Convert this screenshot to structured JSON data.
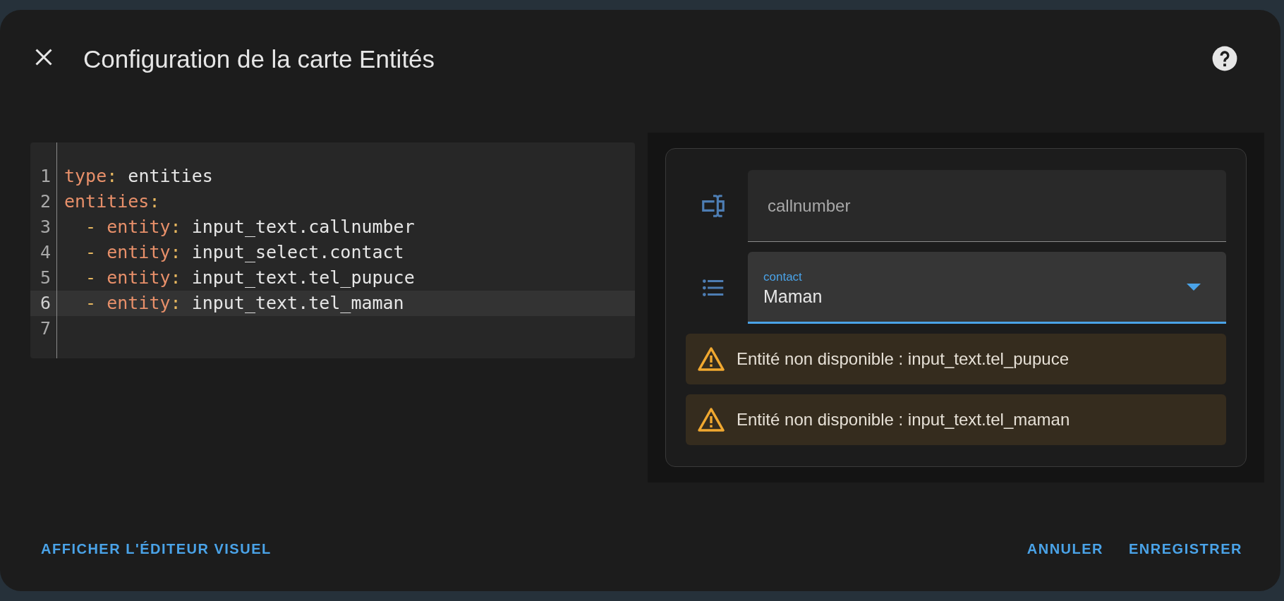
{
  "dialog": {
    "title": "Configuration de la carte Entités"
  },
  "editor": {
    "lines": [
      {
        "number": "1",
        "highlighted": false,
        "tokens": [
          {
            "text": "type",
            "kind": "key"
          },
          {
            "text": ":",
            "kind": "punct"
          },
          {
            "text": " entities",
            "kind": "value"
          }
        ]
      },
      {
        "number": "2",
        "highlighted": false,
        "tokens": [
          {
            "text": "entities",
            "kind": "key"
          },
          {
            "text": ":",
            "kind": "punct"
          }
        ]
      },
      {
        "number": "3",
        "highlighted": false,
        "tokens": [
          {
            "text": "  -",
            "kind": "punct"
          },
          {
            "text": " entity",
            "kind": "key"
          },
          {
            "text": ":",
            "kind": "punct"
          },
          {
            "text": " input_text.callnumber",
            "kind": "value"
          }
        ]
      },
      {
        "number": "4",
        "highlighted": false,
        "tokens": [
          {
            "text": "  -",
            "kind": "punct"
          },
          {
            "text": " entity",
            "kind": "key"
          },
          {
            "text": ":",
            "kind": "punct"
          },
          {
            "text": " input_select.contact",
            "kind": "value"
          }
        ]
      },
      {
        "number": "5",
        "highlighted": false,
        "tokens": [
          {
            "text": "  -",
            "kind": "punct"
          },
          {
            "text": " entity",
            "kind": "key"
          },
          {
            "text": ":",
            "kind": "punct"
          },
          {
            "text": " input_text.tel_pupuce",
            "kind": "value"
          }
        ]
      },
      {
        "number": "6",
        "highlighted": true,
        "tokens": [
          {
            "text": "  -",
            "kind": "punct"
          },
          {
            "text": " entity",
            "kind": "key"
          },
          {
            "text": ":",
            "kind": "punct"
          },
          {
            "text": " input_text.tel_maman",
            "kind": "value"
          }
        ]
      },
      {
        "number": "7",
        "highlighted": false
      }
    ]
  },
  "preview": {
    "rows": [
      {
        "kind": "text_input",
        "value": "callnumber"
      },
      {
        "kind": "select",
        "label": "contact",
        "value": "Maman",
        "focused": true
      },
      {
        "kind": "warning",
        "message": "Entité non disponible : input_text.tel_pupuce"
      },
      {
        "kind": "warning",
        "message": "Entité non disponible : input_text.tel_maman"
      }
    ]
  },
  "footer": {
    "left_button": "AFFICHER L'ÉDITEUR VISUEL",
    "right_buttons": [
      "ANNULER",
      "ENREGISTRER"
    ]
  }
}
